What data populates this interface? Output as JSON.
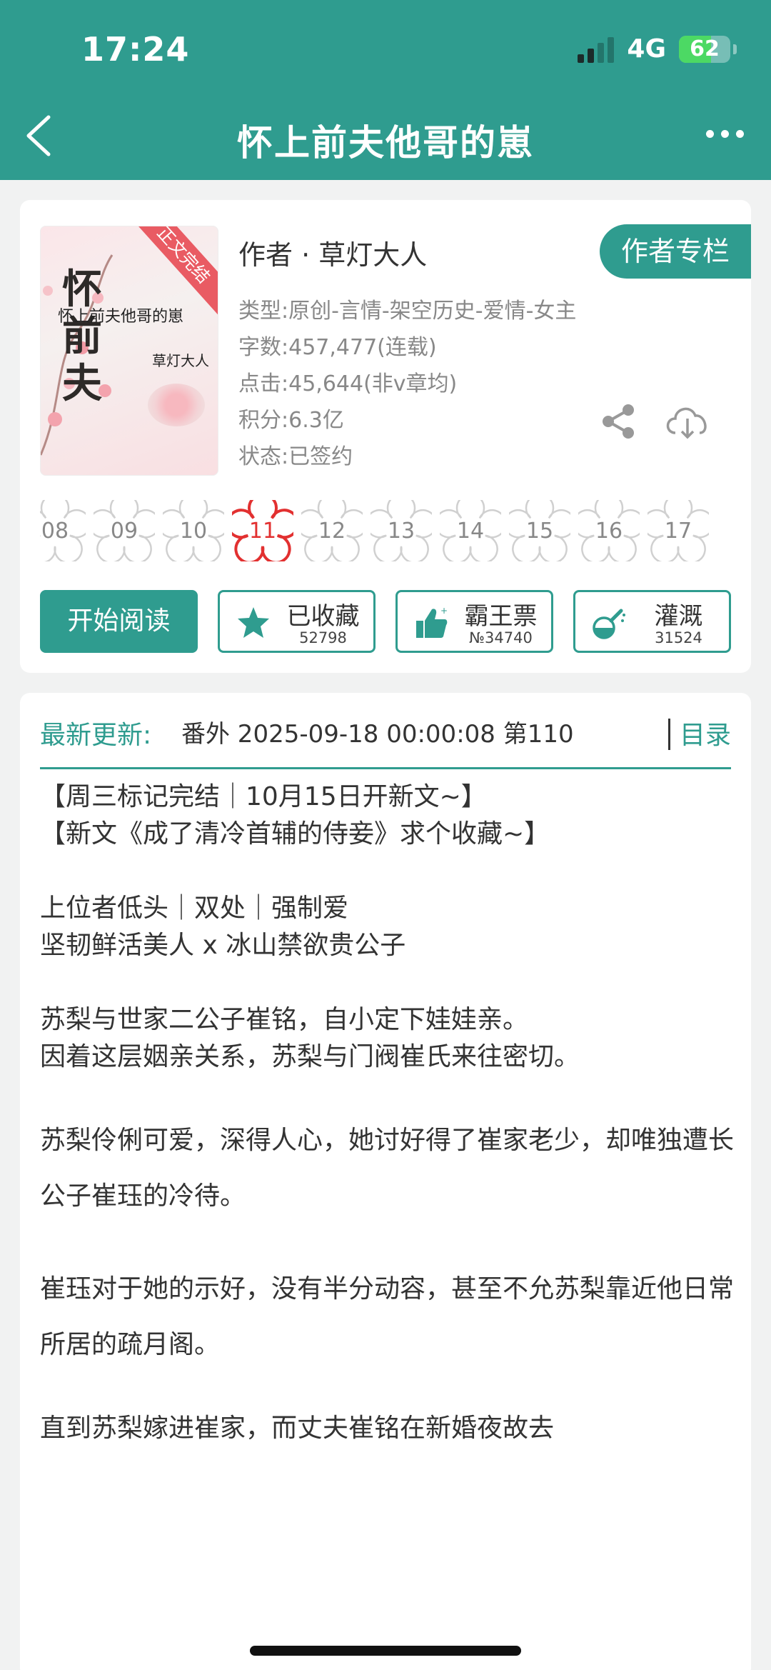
{
  "status_bar": {
    "time": "17:24",
    "network": "4G",
    "battery": "62",
    "battery_level": 0.62
  },
  "nav": {
    "title": "怀上前夫他哥的崽"
  },
  "book": {
    "cover_ribbon": "正文完结",
    "cover_title": "怀上前夫他哥的崽",
    "cover_calligraphy": "怀上前夫他哥的崽",
    "cover_author": "草灯大人",
    "author_line": "作者 · 草灯大人",
    "author_column_label": "作者专栏",
    "meta": [
      "类型:原创-言情-架空历史-爱情-女主",
      "字数:457,477(连载)",
      "点击:45,644(非v章均)",
      "积分:6.3亿",
      "状态:已签约"
    ]
  },
  "chapters": [
    "08",
    "09",
    "10",
    "11",
    "12",
    "13",
    "14",
    "15",
    "16",
    "17"
  ],
  "current_chapter": "11",
  "actions": {
    "read_label": "开始阅读",
    "collect_label": "已收藏",
    "collect_count": "52798",
    "ticket_label": "霸王票",
    "ticket_rank": "№34740",
    "water_label": "灌溉",
    "water_count": "31524"
  },
  "update": {
    "label": "最新更新:",
    "text": "番外 2025-09-18 00:00:08  第110",
    "toc_label": "目录"
  },
  "synopsis": [
    "【周三标记完结｜10月15日开新文~】",
    "【新文《成了清冷首辅的侍妾》求个收藏~】",
    "",
    "上位者低头｜双处｜强制爱",
    "坚韧鲜活美人 x 冰山禁欲贵公子",
    "",
    "苏梨与世家二公子崔铭，自小定下娃娃亲。",
    "因着这层姻亲关系，苏梨与门阀崔氏来往密切。",
    "",
    "苏梨伶俐可爱，深得人心，她讨好得了崔家老少，却唯独遭长公子崔珏的冷待。",
    "",
    "崔珏对于她的示好，没有半分动容，甚至不允苏梨靠近他日常所居的疏月阁。",
    "",
    "直到苏梨嫁进崔家，而丈夫崔铭在新婚夜故去"
  ],
  "colors": {
    "primary": "#2f9c8f",
    "current_chapter": "#e23030",
    "meta_text": "#888888"
  },
  "icons": [
    "back-arrow-icon",
    "more-dots-icon",
    "share-icon",
    "download-icon",
    "star-icon",
    "thumbs-up-icon",
    "watering-icon",
    "flower-badge-icon"
  ]
}
